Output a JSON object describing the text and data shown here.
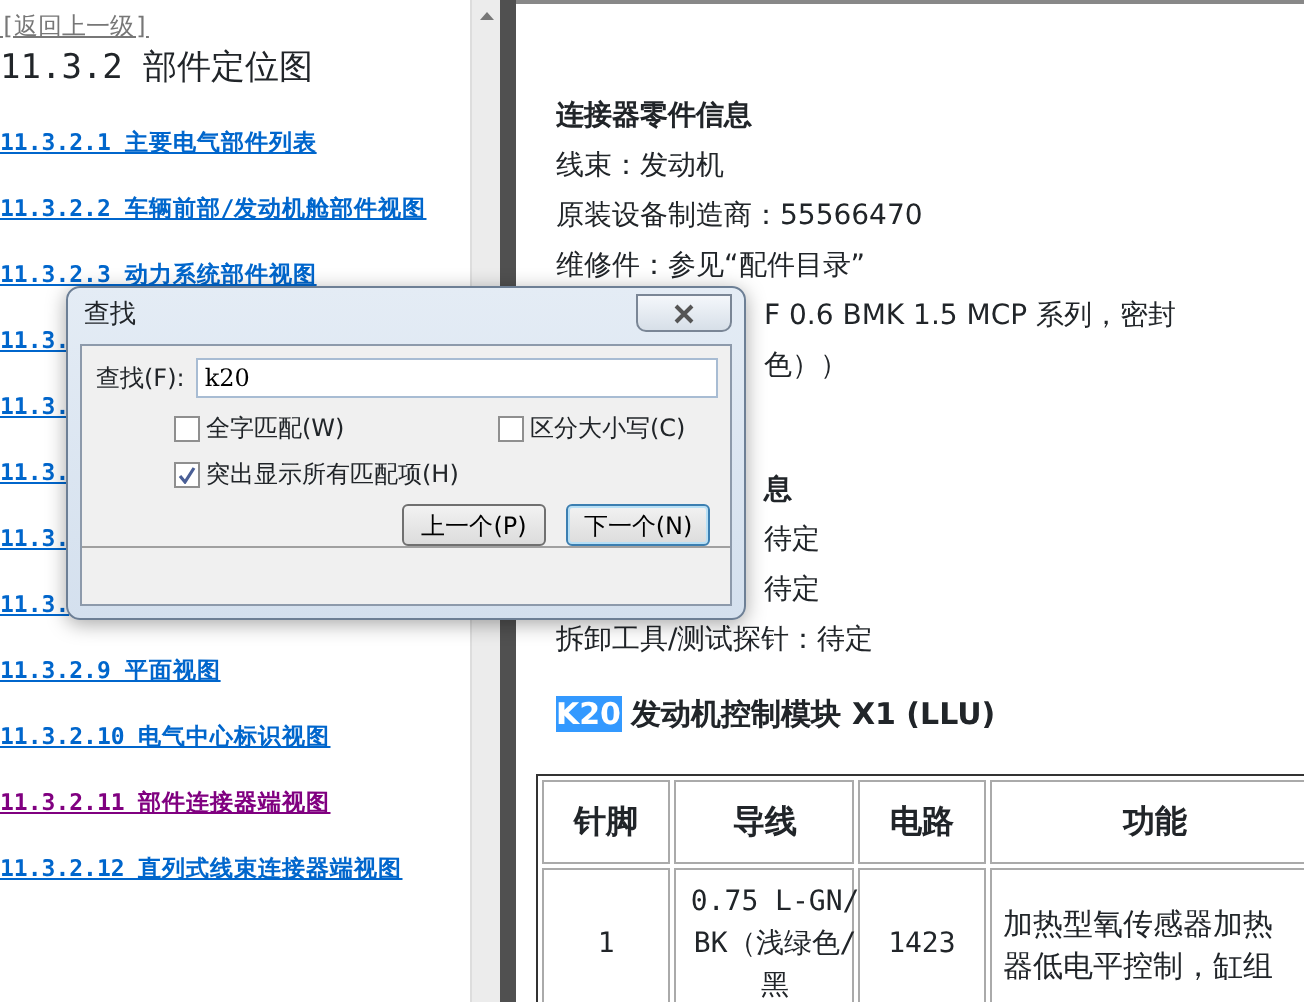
{
  "left_pane": {
    "back_link": "[返回上一级]",
    "title": "11.3.2 部件定位图",
    "links": [
      {
        "text": "11.3.2.1 主要电气部件列表",
        "visited": false
      },
      {
        "text": "11.3.2.2 车辆前部/发动机舱部件视图",
        "visited": false
      },
      {
        "text": "11.3.2.3 动力系统部件视图",
        "visited": false
      },
      {
        "text": "11.3.",
        "visited": false
      },
      {
        "text": "11.3.",
        "visited": false
      },
      {
        "text": "11.3.",
        "visited": false
      },
      {
        "text": "11.3.",
        "visited": false
      },
      {
        "text": "11.3.",
        "visited": false
      },
      {
        "text": "11.3.2.9 平面视图",
        "visited": false
      },
      {
        "text": "11.3.2.10 电气中心标识视图",
        "visited": false
      },
      {
        "text": "11.3.2.11 部件连接器端视图",
        "visited": true
      },
      {
        "text": "11.3.2.12 直列式线束连接器端视图",
        "visited": false
      }
    ]
  },
  "right_pane": {
    "lines": [
      {
        "kind": "heading",
        "text": "连接器零件信息"
      },
      {
        "kind": "line",
        "text": "线束：发动机"
      },
      {
        "kind": "line",
        "text": "原装设备制造商：55566470"
      },
      {
        "kind": "line",
        "text": "维修件：参见“配件目录”"
      },
      {
        "kind": "partial",
        "text": "F 0.6 BMK 1.5 MCP 系列，密封"
      },
      {
        "kind": "partial",
        "text": "色））"
      },
      {
        "kind": "gap"
      },
      {
        "kind": "partial-heading",
        "text": "息"
      },
      {
        "kind": "partial",
        "text": "待定"
      },
      {
        "kind": "partial",
        "text": "待定"
      },
      {
        "kind": "line",
        "text": "拆卸工具/测试探针：待定"
      }
    ],
    "connector_title": [
      {
        "text": "K20",
        "highlighted": true
      },
      {
        "text": "发动机控制模块  X1 (LLU)",
        "highlighted": false
      }
    ],
    "table": {
      "columns": [
        "针脚",
        "导线",
        "电路",
        "功能"
      ],
      "rows": [
        [
          "1",
          "0.75 L-GN/BK（浅绿色/黑",
          "1423",
          "加热型氧传感器加热器低电平控制，缸组"
        ]
      ]
    }
  },
  "find_dialog": {
    "title": "查找",
    "field_label": "查找(F):",
    "value": "k20",
    "options": [
      {
        "label": "全字匹配(W)",
        "checked": false
      },
      {
        "label": "区分大小写(C)",
        "checked": false
      },
      {
        "label": "突出显示所有匹配项(H)",
        "checked": true
      }
    ],
    "buttons": [
      {
        "label": "上一个(P)",
        "default": false
      },
      {
        "label": "下一个(N)",
        "default": true
      }
    ]
  }
}
